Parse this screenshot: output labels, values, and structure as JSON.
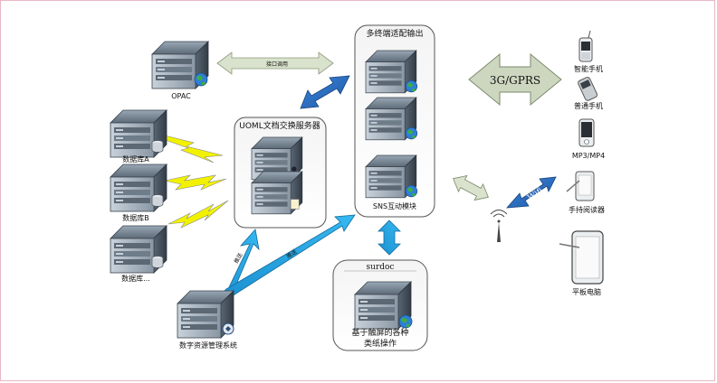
{
  "opac": {
    "label": "OPAC",
    "link_label": "接口调用"
  },
  "databases": [
    "数据库A",
    "数据库B",
    "数据库..."
  ],
  "uoml_box": {
    "title": "UOML文档交换服务器"
  },
  "output_box": {
    "title": "多终端适配输出",
    "sns_label": "SNS互动模块"
  },
  "surdoc_box": {
    "title": "surdoc",
    "desc_line1": "基于触屏的各种",
    "desc_line2": "类纸操作"
  },
  "dam": {
    "label": "数字资源管理系统"
  },
  "arrows": {
    "network_label": "3G/GPRS",
    "wifi_label": "Wifi",
    "diag_label1": "推送",
    "diag_label2": "推送"
  },
  "devices": [
    "智能手机",
    "普通手机",
    "MP3/MP4",
    "手持阅读器",
    "平板电脑"
  ],
  "colors": {
    "server_body": "#4a5a6a",
    "server_front": "#a8b4c0",
    "blue_arrow": "#2f6fc4",
    "cyan_arrow": "#1fa3e0",
    "gray_arrow": "#cdd6bf",
    "bolt": "#f2f200",
    "frame": "#e8b7c3"
  }
}
